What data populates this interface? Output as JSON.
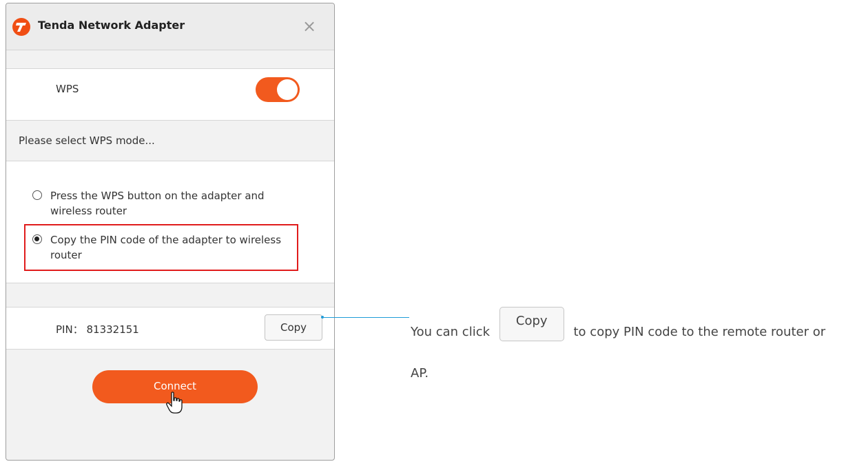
{
  "window": {
    "title": "Tenda Network Adapter",
    "close_glyph": "×",
    "logo_icon": "tenda-logo-icon"
  },
  "wps": {
    "label": "WPS",
    "enabled": true,
    "accent": "#f25a1e"
  },
  "mode_prompt": "Please select WPS mode...",
  "modes": [
    {
      "label": "Press the WPS button on the adapter and wireless router",
      "selected": false
    },
    {
      "label": "Copy the PIN code of the adapter to wireless router",
      "selected": true
    }
  ],
  "pin": {
    "label": "PIN：",
    "value": "81332151",
    "copy_label": "Copy"
  },
  "connect_label": "Connect",
  "annotation": {
    "before": "You can click",
    "button_label": "Copy",
    "after": "to copy PIN code to the remote router or AP.",
    "line_color": "#1e9bd7",
    "highlight_color": "#e01b1b"
  }
}
